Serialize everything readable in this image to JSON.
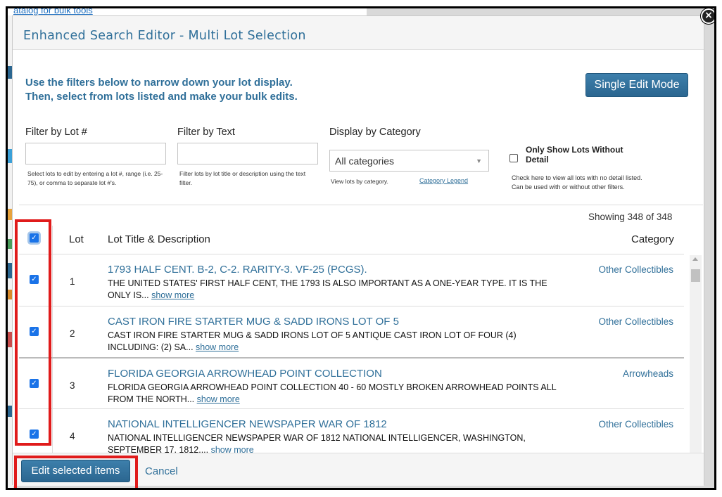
{
  "background": {
    "top_text": "atalog for bulk tools"
  },
  "modal": {
    "title": "Enhanced Search Editor - Multi Lot Selection",
    "close_glyph": "×"
  },
  "instructions": "Use the filters below to narrow down your lot display. Then, select from lots listed and make your bulk edits.",
  "single_edit_button": "Single Edit Mode",
  "filters": {
    "lot": {
      "label": "Filter by Lot #",
      "value": "",
      "help": "Select lots to edit by entering a lot #, range (i.e. 25-75), or comma to separate lot #'s."
    },
    "text": {
      "label": "Filter by Text",
      "value": "",
      "help": "Filter lots by lot title or description using the text filter."
    },
    "category": {
      "label": "Display by Category",
      "selected": "All categories",
      "help": "View lots by category.",
      "legend_link": "Category Legend"
    },
    "no_detail": {
      "label": "Only Show Lots Without Detail",
      "checked": false,
      "help_line1": "Check here to view all lots with no detail listed.",
      "help_line2": "Can be used with or without other filters."
    }
  },
  "showing": "Showing 348 of 348",
  "table": {
    "headers": {
      "lot": "Lot",
      "title": "Lot Title & Description",
      "category": "Category"
    },
    "select_all_checked": true,
    "rows": [
      {
        "lot": "1",
        "title": "1793 HALF CENT. B-2, C-2. RARITY-3. VF-25 (PCGS).",
        "desc": "THE UNITED STATES' FIRST HALF CENT, THE 1793 IS ALSO IMPORTANT AS A ONE-YEAR TYPE. IT IS THE ONLY IS...",
        "more": "show more",
        "category": "Other Collectibles",
        "checked": true
      },
      {
        "lot": "2",
        "title": "CAST IRON FIRE STARTER MUG & SADD IRONS LOT OF 5",
        "desc": "CAST IRON FIRE STARTER MUG & SADD IRONS LOT OF 5 ANTIQUE CAST IRON LOT OF FOUR (4) INCLUDING: (2) SA...",
        "more": "show more",
        "category": "Other Collectibles",
        "checked": true
      },
      {
        "lot": "3",
        "title": "FLORIDA GEORGIA ARROWHEAD POINT COLLECTION",
        "desc": "FLORIDA GEORGIA ARROWHEAD POINT COLLECTION 40 - 60 MOSTLY BROKEN ARROWHEAD POINTS ALL FROM THE NORTH...",
        "more": "show more",
        "category": "Arrowheads",
        "checked": true
      },
      {
        "lot": "4",
        "title": "NATIONAL INTELLIGENCER NEWSPAPER WAR OF 1812",
        "desc": "NATIONAL INTELLIGENCER NEWSPAPER WAR OF 1812 NATIONAL INTELLIGENCER, WASHINGTON, SEPTEMBER 17, 1812....",
        "more": "show more",
        "category": "Other Collectibles",
        "checked": true
      }
    ]
  },
  "footer": {
    "edit_selected": "Edit selected items",
    "cancel": "Cancel"
  },
  "colors": {
    "accent": "#2f6f99",
    "button": "#2b6690",
    "checkbox": "#1a73e8",
    "highlight": "#e01b1b"
  },
  "icons": {
    "close": "close-icon",
    "checkbox": "check-icon",
    "caret": "chevron-down-icon"
  }
}
